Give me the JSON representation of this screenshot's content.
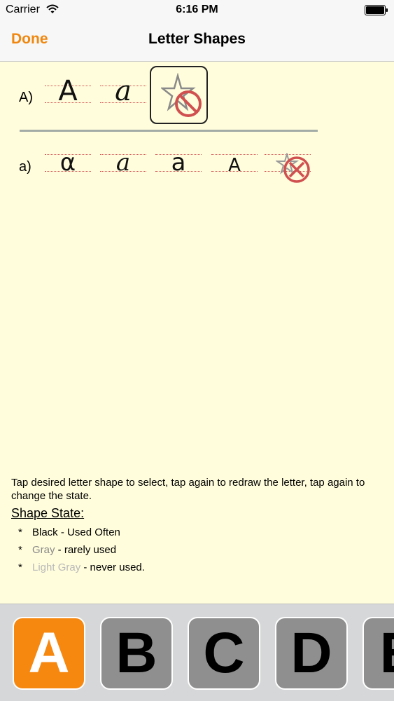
{
  "status_bar": {
    "carrier": "Carrier",
    "time": "6:16 PM",
    "wifi_icon": "wifi-icon",
    "battery_icon": "battery-full-icon"
  },
  "nav": {
    "done_label": "Done",
    "title": "Letter Shapes",
    "accent_color": "#f0870f"
  },
  "uppercase_row": {
    "label": "A)",
    "shapes": [
      {
        "glyph": "A",
        "state": "Black - Used Often"
      },
      {
        "glyph": "a",
        "state": "Black - Used Often"
      },
      {
        "icon": "star-prohibited-icon",
        "selected": true
      }
    ]
  },
  "lowercase_row": {
    "label": "a)",
    "shapes": [
      {
        "glyph": "α",
        "state": "Black - Used Often"
      },
      {
        "glyph": "a",
        "state": "Black - Used Often"
      },
      {
        "glyph": "a",
        "state": "Black - Used Often"
      },
      {
        "glyph": "A",
        "state": "Black - Used Often"
      },
      {
        "icon": "star-cancel-icon"
      }
    ]
  },
  "instructions": "Tap desired letter shape to select, tap again to redraw the letter, tap again to change the state.",
  "legend": {
    "title": "Shape State:",
    "bullet": "*",
    "items": [
      {
        "colored": "Black",
        "rest": " - Used Often",
        "color": "#000000"
      },
      {
        "colored": "Gray",
        "rest": " - rarely used",
        "color": "#8a8a8a"
      },
      {
        "colored": "Light Gray",
        "rest": " - never used.",
        "color": "#b8b8b8"
      }
    ]
  },
  "letter_bar": {
    "keys": [
      "A",
      "B",
      "C",
      "D",
      "E"
    ],
    "selected": "A",
    "selected_color": "#f6870f",
    "key_color": "#8f8f8f"
  }
}
